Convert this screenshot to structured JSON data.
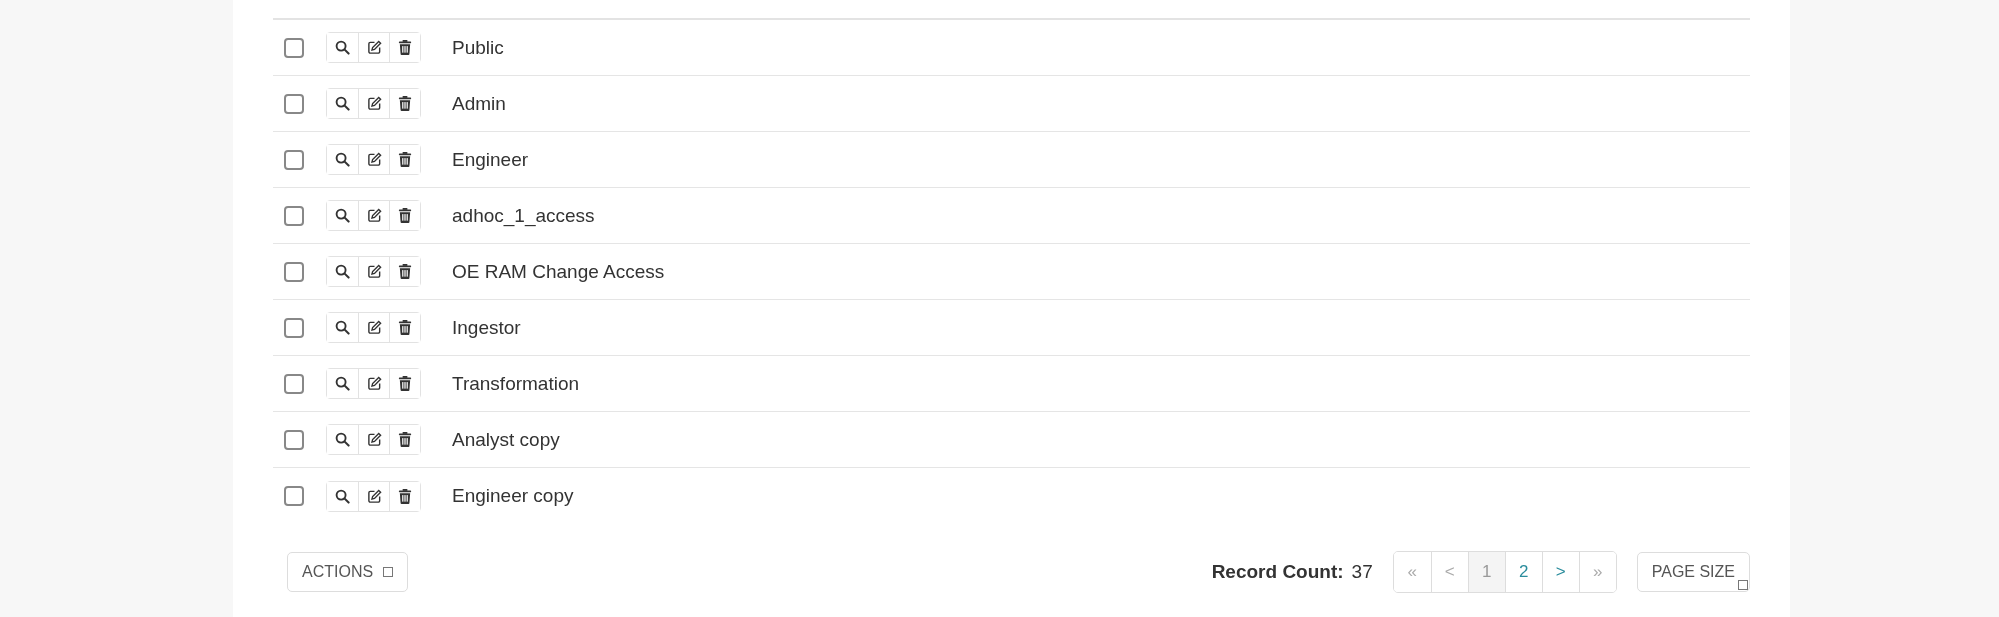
{
  "rows": [
    {
      "name": "Public",
      "checked": false
    },
    {
      "name": "Admin",
      "checked": false
    },
    {
      "name": "Engineer",
      "checked": false
    },
    {
      "name": "adhoc_1_access",
      "checked": false
    },
    {
      "name": "OE RAM Change Access",
      "checked": false
    },
    {
      "name": "Ingestor",
      "checked": false
    },
    {
      "name": "Transformation",
      "checked": false
    },
    {
      "name": "Analyst copy",
      "checked": false
    },
    {
      "name": "Engineer copy",
      "checked": false
    }
  ],
  "actions_button": "ACTIONS",
  "record_count": {
    "label": "Record Count:",
    "value": "37"
  },
  "pagination": [
    {
      "label": "«",
      "selected": false,
      "disabled": true
    },
    {
      "label": "<",
      "selected": false,
      "disabled": true
    },
    {
      "label": "1",
      "selected": true,
      "disabled": false
    },
    {
      "label": "2",
      "selected": false,
      "disabled": false
    },
    {
      "label": ">",
      "selected": false,
      "disabled": false
    },
    {
      "label": "»",
      "selected": false,
      "disabled": true
    }
  ],
  "page_size_button": "PAGE SIZE"
}
